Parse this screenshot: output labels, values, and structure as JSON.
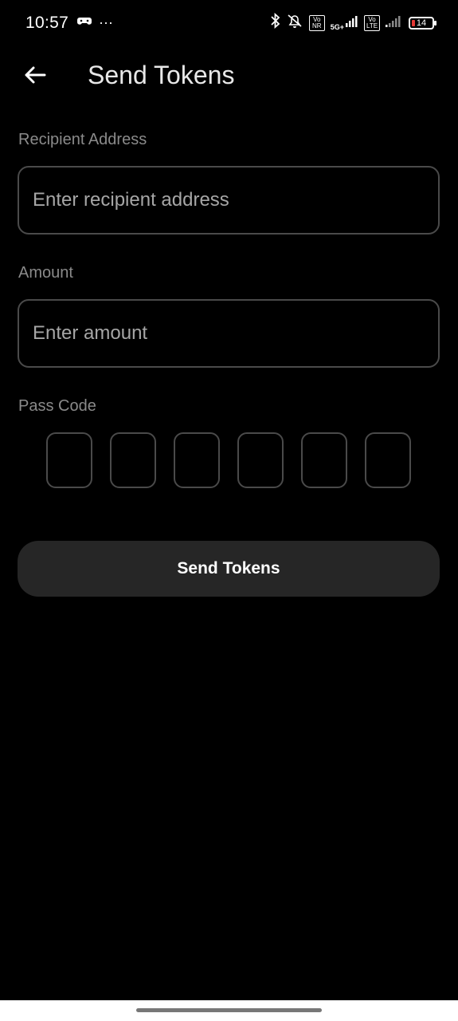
{
  "status_bar": {
    "time": "10:57",
    "overflow_dots": "···",
    "badge_volte_1": "Vo NR",
    "network_5g": "5G+",
    "badge_volte_2": "Vo LTE",
    "battery_level": "14",
    "battery_color": "#e53935",
    "icons": [
      "game-controller-icon",
      "bluetooth-icon",
      "silent-icon",
      "signal-icon",
      "signal-weak-icon",
      "battery-icon"
    ]
  },
  "header": {
    "title": "Send Tokens",
    "back_icon": "arrow-left-icon"
  },
  "form": {
    "recipient": {
      "label": "Recipient Address",
      "placeholder": "Enter recipient address",
      "value": ""
    },
    "amount": {
      "label": "Amount",
      "placeholder": "Enter amount",
      "value": ""
    },
    "passcode": {
      "label": "Pass Code",
      "digits": [
        "",
        "",
        "",
        "",
        "",
        ""
      ]
    },
    "submit_label": "Send Tokens"
  }
}
